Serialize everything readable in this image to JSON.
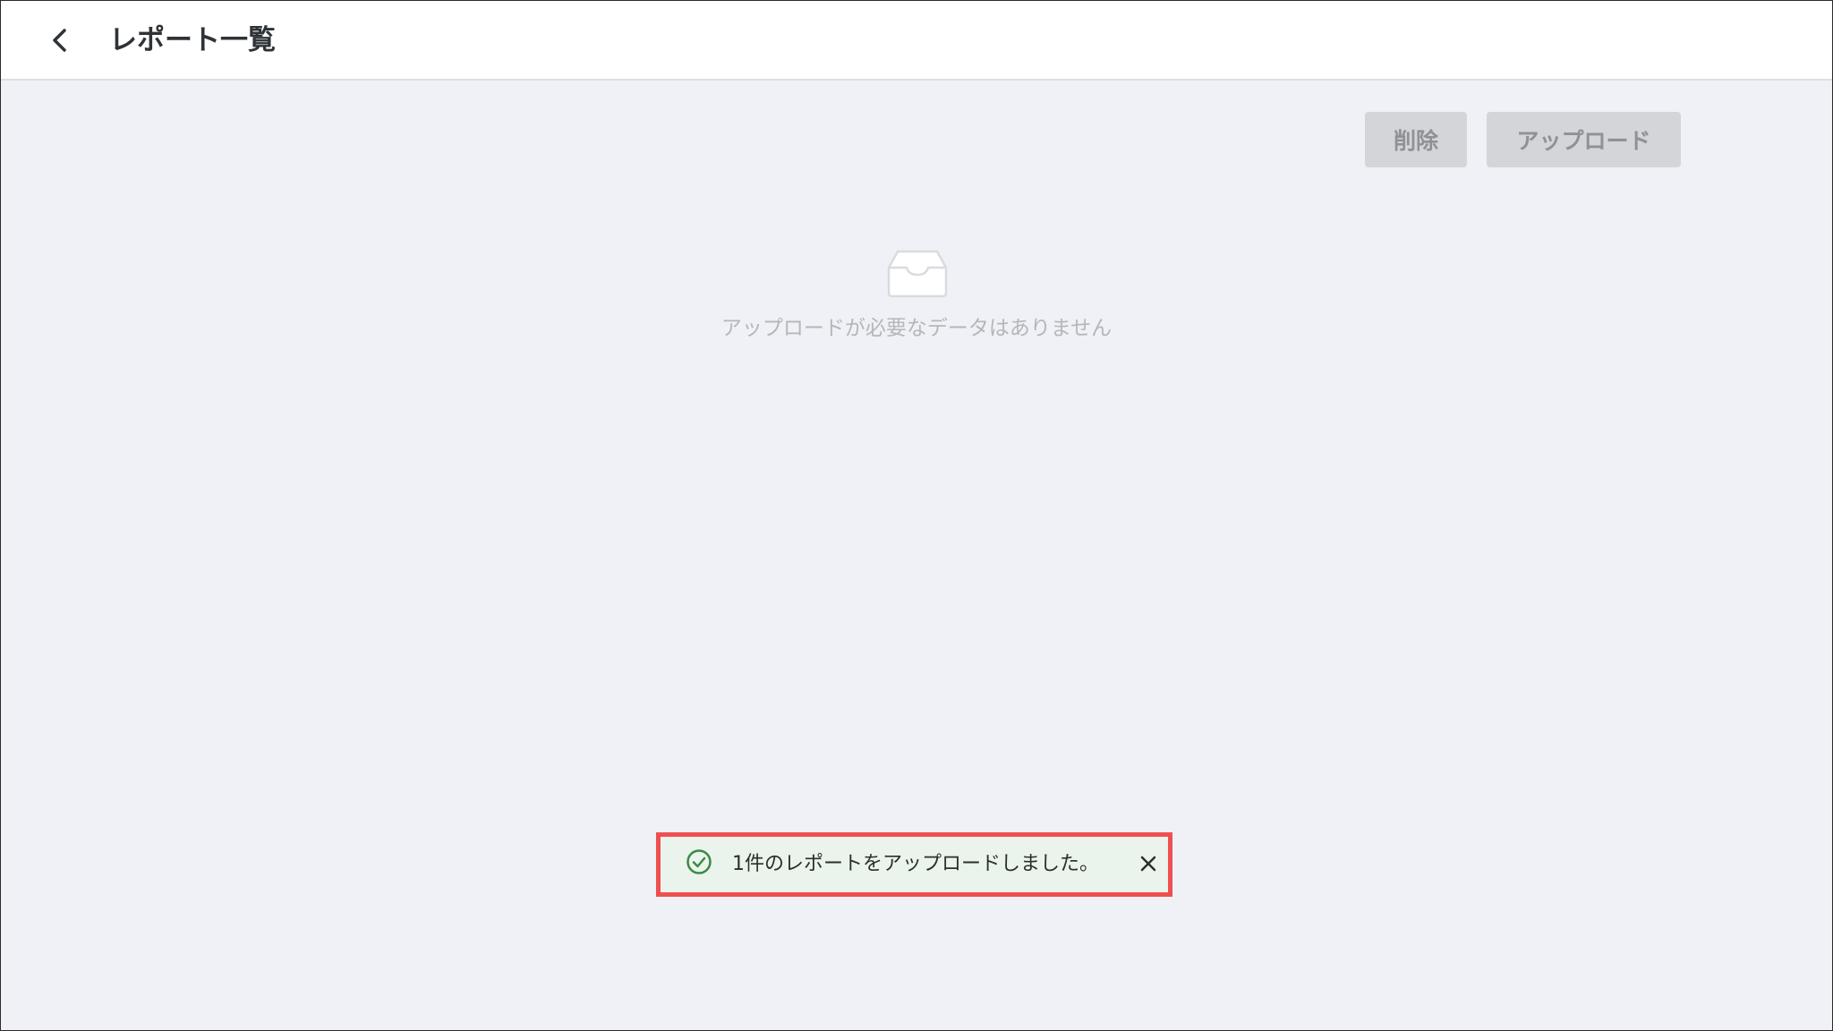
{
  "header": {
    "back_icon": "chevron-left-icon",
    "title": "レポート一覧"
  },
  "toolbar": {
    "delete_label": "削除",
    "upload_label": "アップロード"
  },
  "empty_state": {
    "icon": "inbox-icon",
    "message": "アップロードが必要なデータはありません"
  },
  "toast": {
    "icon": "check-circle-icon",
    "message": "1件のレポートをアップロードしました。",
    "close_icon": "close-icon",
    "icon_color": "#3a8a45",
    "highlight_color": "#ef4f4f"
  },
  "colors": {
    "background": "#eff1f6",
    "header_background": "#ffffff",
    "button_disabled": "#d4d5d9",
    "button_text_disabled": "#8f9196"
  }
}
